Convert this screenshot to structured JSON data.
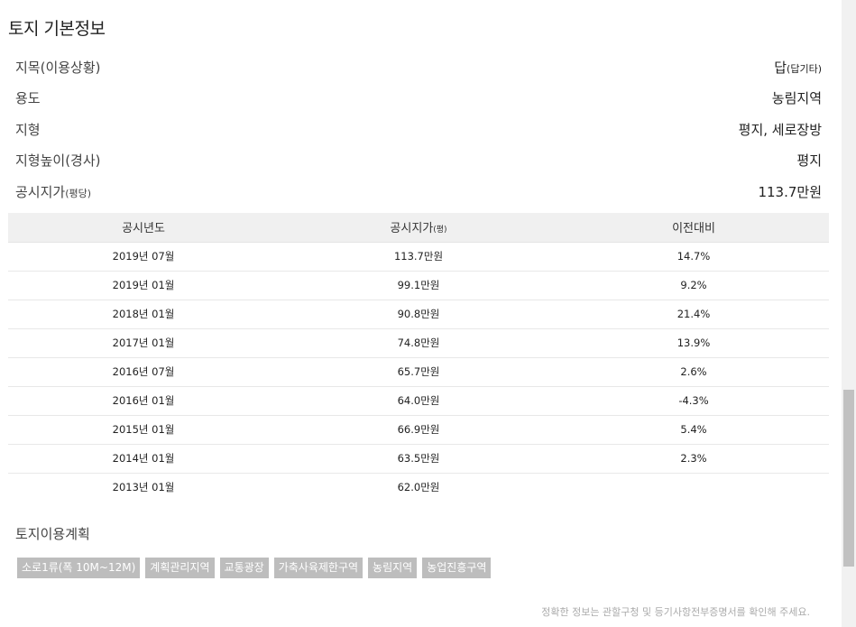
{
  "section_title": "토지 기본정보",
  "info": {
    "jimok": {
      "label": "지목(이용상황)",
      "value_main": "답",
      "value_sub": "(답기타)"
    },
    "yongdo": {
      "label": "용도",
      "value": "농림지역"
    },
    "jihyeong": {
      "label": "지형",
      "value": "평지, 세로장방"
    },
    "nopi": {
      "label": "지형높이(경사)",
      "value": "평지"
    },
    "price": {
      "label_main": "공시지가",
      "label_sub": "(평당)",
      "value": "113.7만원"
    }
  },
  "table": {
    "headers": {
      "year": "공시년도",
      "price_main": "공시지가",
      "price_sub": "(평)",
      "change": "이전대비"
    },
    "rows": [
      {
        "year": "2019년 07월",
        "price": "113.7만원",
        "change": "14.7%"
      },
      {
        "year": "2019년 01월",
        "price": "99.1만원",
        "change": "9.2%"
      },
      {
        "year": "2018년 01월",
        "price": "90.8만원",
        "change": "21.4%"
      },
      {
        "year": "2017년 01월",
        "price": "74.8만원",
        "change": "13.9%"
      },
      {
        "year": "2016년 07월",
        "price": "65.7만원",
        "change": "2.6%"
      },
      {
        "year": "2016년 01월",
        "price": "64.0만원",
        "change": "-4.3%"
      },
      {
        "year": "2015년 01월",
        "price": "66.9만원",
        "change": "5.4%"
      },
      {
        "year": "2014년 01월",
        "price": "63.5만원",
        "change": "2.3%"
      },
      {
        "year": "2013년 01월",
        "price": "62.0만원",
        "change": ""
      }
    ]
  },
  "plan": {
    "title": "토지이용계획",
    "tags": [
      "소로1류(폭 10M~12M)",
      "계획관리지역",
      "교통광장",
      "가축사육제한구역",
      "농림지역",
      "농업진흥구역"
    ]
  },
  "footnote": "정확한 정보는 관할구청 및 등기사항전부증명서를 확인해 주세요.",
  "colors": {
    "increase": "#e02020",
    "decrease": "#1a1aff",
    "tag_bg": "#bdbdbd",
    "header_bg": "#f0f0f0"
  }
}
